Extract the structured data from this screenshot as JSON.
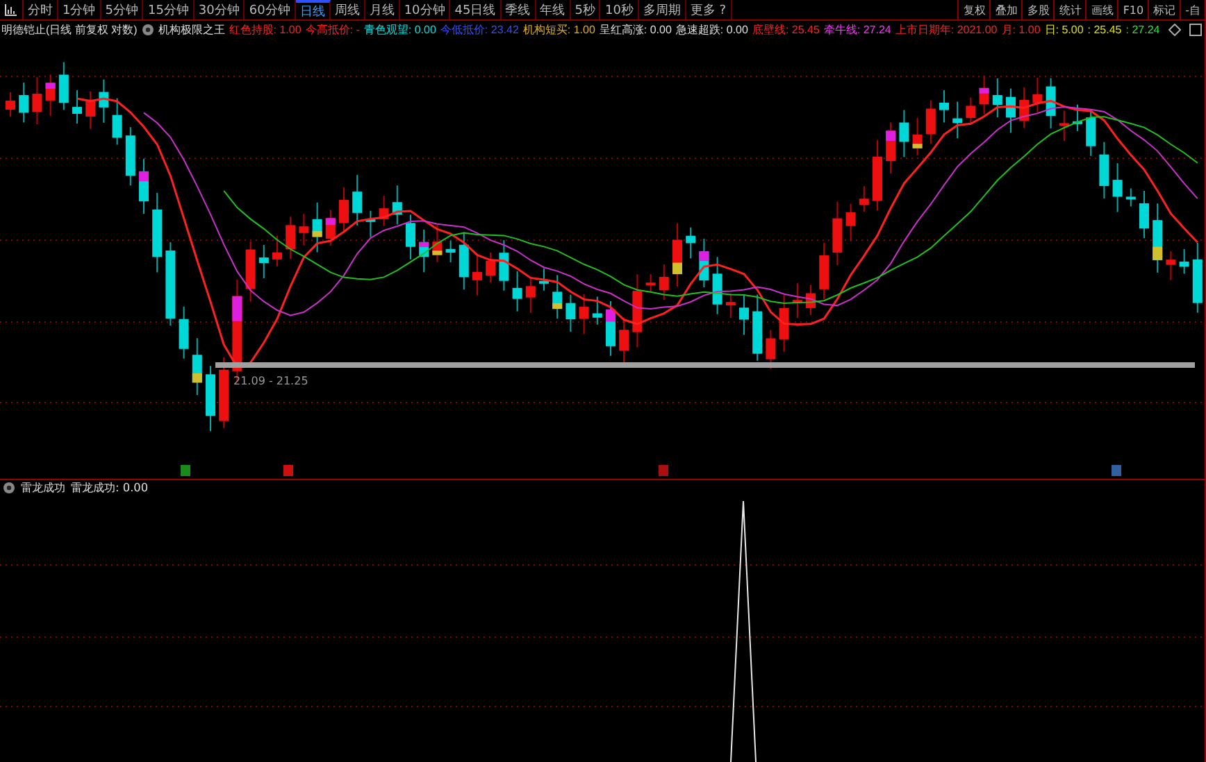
{
  "toolbar": {
    "tabs": [
      {
        "label": "分时",
        "selected": false
      },
      {
        "label": "1分钟",
        "selected": false
      },
      {
        "label": "5分钟",
        "selected": false
      },
      {
        "label": "15分钟",
        "selected": false
      },
      {
        "label": "30分钟",
        "selected": false
      },
      {
        "label": "60分钟",
        "selected": false
      },
      {
        "label": "日线",
        "selected": true
      },
      {
        "label": "周线",
        "selected": false
      },
      {
        "label": "月线",
        "selected": false
      },
      {
        "label": "10分钟",
        "selected": false
      },
      {
        "label": "45日线",
        "selected": false
      },
      {
        "label": "季线",
        "selected": false
      },
      {
        "label": "年线",
        "selected": false
      },
      {
        "label": "5秒",
        "selected": false
      },
      {
        "label": "10秒",
        "selected": false
      },
      {
        "label": "多周期",
        "selected": false
      },
      {
        "label": "更多 ?",
        "selected": false
      }
    ],
    "buttons": [
      "复权",
      "叠加",
      "多股",
      "统计",
      "画线",
      "F10",
      "标记",
      "-自"
    ]
  },
  "indicator_bar": {
    "title": "明德铠止(日线 前复权 对数)",
    "name": "机构极限之王",
    "values": [
      {
        "text": "红色持股: 1.00",
        "color": "#ff2020"
      },
      {
        "text": "今高抵价: -",
        "color": "#ff2020"
      },
      {
        "text": "青色观望: 0.00",
        "color": "#00e0e0"
      },
      {
        "text": "今低抵价: 23.42",
        "color": "#3050ff"
      },
      {
        "text": "机构短买: 1.00",
        "color": "#e0b020"
      },
      {
        "text": "呈红高涨: 0.00",
        "color": "#e0e0e0"
      },
      {
        "text": "急速超跌: 0.00",
        "color": "#e0e0e0"
      },
      {
        "text": "底壁线: 25.45",
        "color": "#ff2020"
      },
      {
        "text": "牵牛线: 27.24",
        "color": "#ff30ff"
      },
      {
        "text": "上市日期年: 2021.00",
        "color": "#ff2020"
      },
      {
        "text": "月: 1.00",
        "color": "#ff2020"
      },
      {
        "text": "日: 5.00",
        "color": "#e0e000"
      },
      {
        "text": ": 25.45",
        "color": "#e0e000"
      },
      {
        "text": ": 27.24",
        "color": "#30e030"
      }
    ]
  },
  "main_chart": {
    "range_label": "21.09 - 21.25"
  },
  "sub_panel": {
    "title": "雷龙成功",
    "values": [
      {
        "text": "雷龙成功: 0.00",
        "color": "#e0e0e0"
      }
    ]
  }
}
